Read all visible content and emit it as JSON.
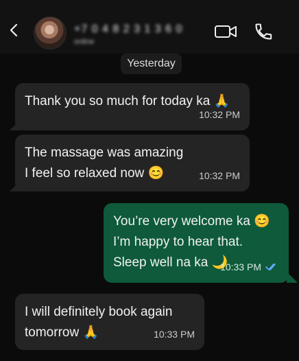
{
  "header": {
    "contact_name": "+7 0 4 8 2 3 1 3 6 0",
    "contact_status": "online"
  },
  "chat": {
    "date_label": "Yesterday",
    "messages": [
      {
        "lines": [
          "Thank you so much for today ka 🙏"
        ],
        "time": "10:32 PM"
      },
      {
        "lines": [
          "The massage was amazing",
          "I feel so relaxed now 😊"
        ],
        "time": "10:32 PM"
      },
      {
        "lines": [
          "You’re very welcome ka 😊",
          "I’m happy to hear that.",
          "Sleep well na ka 🌙"
        ],
        "time": "10:33 PM"
      },
      {
        "lines": [
          "I will definitely book again",
          "tomorrow 🙏"
        ],
        "time": "10:33 PM"
      }
    ]
  },
  "icons": {
    "back": "chevron-left-icon",
    "video": "video-call-icon",
    "call": "phone-icon",
    "read": "double-check-icon"
  },
  "colors": {
    "incoming_bubble": "#242424",
    "outgoing_bubble": "#0e5a3b",
    "read_check": "#62a8ff"
  }
}
